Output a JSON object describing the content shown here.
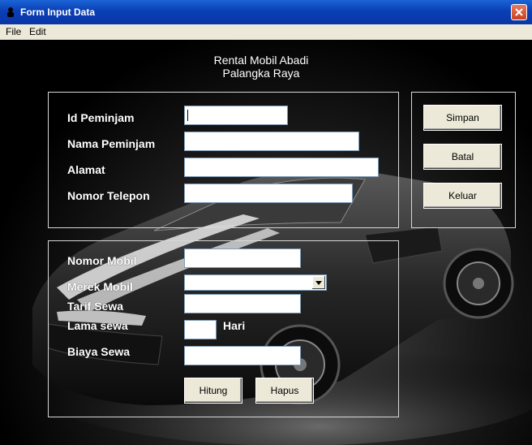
{
  "window": {
    "title": "Form Input Data"
  },
  "menu": {
    "items": [
      "File",
      "Edit"
    ]
  },
  "heading": {
    "line1": "Rental Mobil Abadi",
    "line2": "Palangka Raya"
  },
  "customer": {
    "id_label": "Id Peminjam",
    "id_value": "",
    "name_label": "Nama Peminjam",
    "name_value": "",
    "address_label": "Alamat",
    "address_value": "",
    "phone_label": "Nomor Telepon",
    "phone_value": ""
  },
  "actions": {
    "save": "Simpan",
    "cancel": "Batal",
    "exit": "Keluar"
  },
  "rental": {
    "plate_label": "Nomor Mobil",
    "plate_value": "",
    "brand_label": "Merek Mobil",
    "brand_selected": "",
    "rate_label": "Tarif Sewa",
    "rate_value": "",
    "duration_label": "Lama sewa",
    "duration_value": "",
    "duration_unit": "Hari",
    "cost_label": "Biaya Sewa",
    "cost_value": ""
  },
  "calc_actions": {
    "compute": "Hitung",
    "clear": "Hapus"
  },
  "colors": {
    "titlebar": "#0a3fb5",
    "close": "#c8401f",
    "menubar": "#ece9d8",
    "button": "#ece9d8"
  }
}
